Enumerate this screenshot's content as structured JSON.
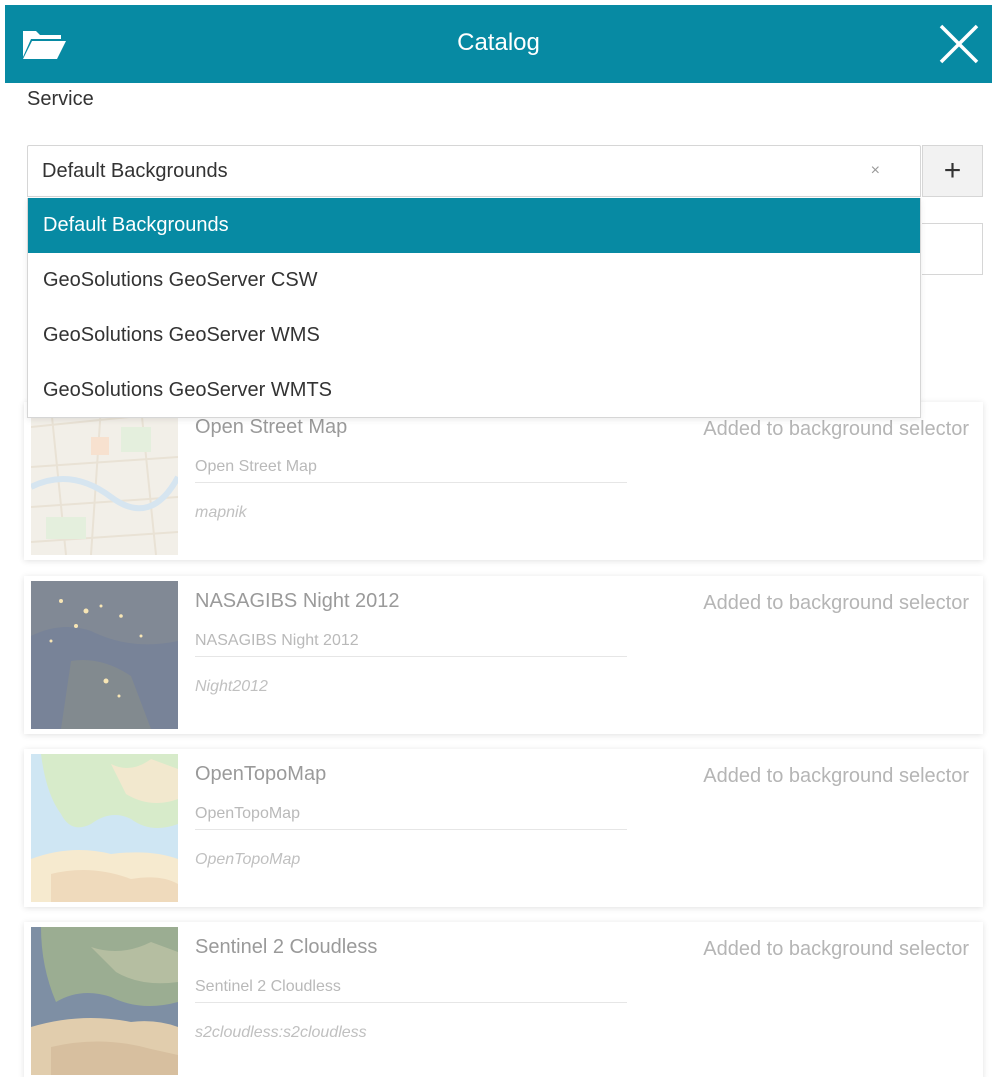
{
  "header": {
    "title": "Catalog",
    "folder_icon": "folder-open-icon",
    "close_icon": "close-icon",
    "color": "#078aa3"
  },
  "service": {
    "label": "Service",
    "selected_value": "Default Backgrounds",
    "clear_symbol": "×",
    "add_symbol": "+"
  },
  "dropdown": {
    "options": [
      {
        "label": "Default Backgrounds",
        "selected": true
      },
      {
        "label": "GeoSolutions GeoServer CSW",
        "selected": false
      },
      {
        "label": "GeoSolutions GeoServer WMS",
        "selected": false
      },
      {
        "label": "GeoSolutions GeoServer WMTS",
        "selected": false
      }
    ]
  },
  "records": [
    {
      "title": "Open Street Map",
      "description": "Open Street Map",
      "layer": "mapnik",
      "status": "Added to background selector",
      "thumbnail": "osm-map-thumbnail"
    },
    {
      "title": "NASAGIBS Night 2012",
      "description": "NASAGIBS Night 2012",
      "layer": "Night2012",
      "status": "Added to background selector",
      "thumbnail": "night-earth-thumbnail"
    },
    {
      "title": "OpenTopoMap",
      "description": "OpenTopoMap",
      "layer": "OpenTopoMap",
      "status": "Added to background selector",
      "thumbnail": "topo-map-thumbnail"
    },
    {
      "title": "Sentinel 2 Cloudless",
      "description": "Sentinel 2 Cloudless",
      "layer": "s2cloudless:s2cloudless",
      "status": "Added to background selector",
      "thumbnail": "satellite-thumbnail"
    }
  ]
}
